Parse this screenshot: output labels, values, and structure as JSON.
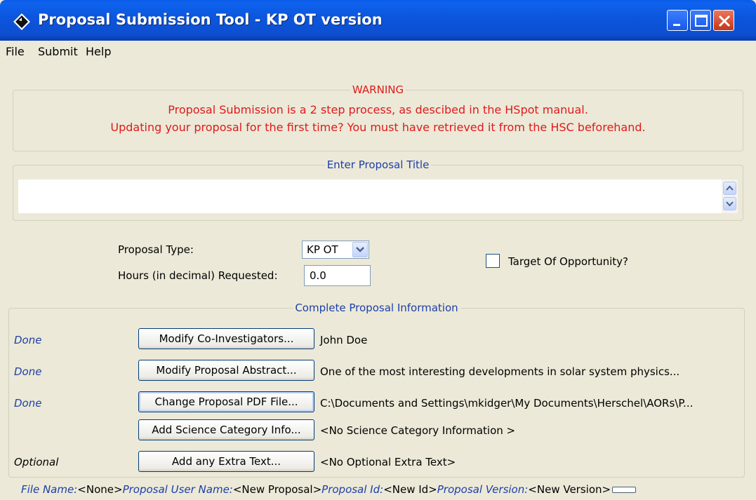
{
  "window": {
    "title": "Proposal Submission Tool - KP OT version"
  },
  "menu": [
    "File",
    "Submit",
    "Help"
  ],
  "warning": {
    "title": "WARNING",
    "line1": "Proposal Submission is a 2 step process, as descibed in the HSpot manual.",
    "line2": "Updating your proposal for the first time? You must have retrieved it from the HSC beforehand."
  },
  "proposal_title": {
    "label": "Enter Proposal Title",
    "value": ""
  },
  "form": {
    "type_label": "Proposal Type:",
    "type_value": "KP OT",
    "hours_label": "Hours (in decimal) Requested:",
    "hours_value": "0.0",
    "too_label": "Target Of Opportunity?",
    "too_checked": false
  },
  "info": {
    "title": "Complete Proposal Information",
    "rows": [
      {
        "status": "Done",
        "button": "Modify Co-Investigators...",
        "text": "John Doe"
      },
      {
        "status": "Done",
        "button": "Modify Proposal Abstract...",
        "text": "One of the most interesting developments in solar system physics..."
      },
      {
        "status": "Done",
        "button": "Change Proposal PDF File...",
        "text": "C:\\Documents and Settings\\mkidger\\My Documents\\Herschel\\AORs\\P..."
      },
      {
        "status": "",
        "button": "Add Science Category Info...",
        "text": "<No Science Category Information >"
      },
      {
        "status": "Optional",
        "button": "Add any Extra Text...",
        "text": "<No Optional Extra Text>"
      }
    ]
  },
  "footer": {
    "file_name_label": "File Name:",
    "file_name_value": "<None>",
    "user_name_label": "Proposal User Name:",
    "user_name_value": "<New Proposal>",
    "id_label": "Proposal Id:",
    "id_value": "<New Id>",
    "version_label": "Proposal Version:",
    "version_value": "<New Version>"
  },
  "colors": {
    "warning_text": "#e01a1a",
    "label_blue": "#1c3fa8",
    "titlebar": "#0d4fd0"
  }
}
